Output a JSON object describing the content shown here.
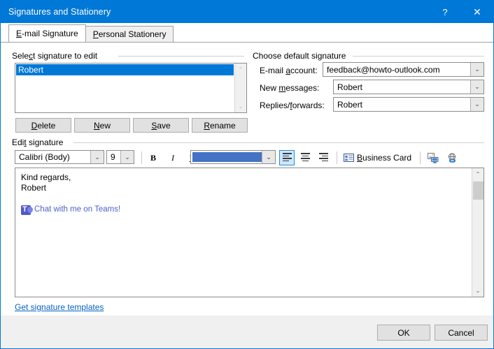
{
  "window": {
    "title": "Signatures and Stationery",
    "help_icon": "?",
    "close_icon": "✕",
    "accent_color": "#0078d7"
  },
  "tabs": [
    {
      "label_pre": "E",
      "label_key": "-",
      "label": "E-mail Signature",
      "accesskey": "E",
      "active": true
    },
    {
      "label": "Personal Stationery",
      "accesskey": "P",
      "active": false
    }
  ],
  "select_signature": {
    "group_label": "Select signature to edit",
    "group_accesskey": "c",
    "items": [
      {
        "name": "Robert",
        "selected": true
      }
    ],
    "scrollbar": {
      "up_icon": "⌃",
      "down_icon": "⌄",
      "disabled": true
    },
    "buttons": [
      {
        "label": "Delete",
        "accesskey": "D"
      },
      {
        "label": "New",
        "accesskey": "N"
      },
      {
        "label": "Save",
        "accesskey": "S"
      },
      {
        "label": "Rename",
        "accesskey": "R"
      }
    ]
  },
  "default_signature": {
    "group_label": "Choose default signature",
    "fields": [
      {
        "label": "E-mail account:",
        "accesskey": "a",
        "value": "feedback@howto-outlook.com"
      },
      {
        "label": "New messages:",
        "accesskey": "m",
        "value": "Robert"
      },
      {
        "label": "Replies/forwards:",
        "accesskey": "f",
        "value": "Robert"
      }
    ],
    "dropdown_icon": "⌄"
  },
  "edit_signature": {
    "group_label": "Edit signature",
    "group_accesskey": "t",
    "toolbar": {
      "font_name": "Calibri (Body)",
      "font_size": "9",
      "bold_label": "B",
      "italic_label": "I",
      "underline_label": "U",
      "font_color": "#4472c4",
      "dropdown_icon": "⌄",
      "align_left_label": "Align Left",
      "align_center_label": "Center",
      "align_right_label": "Align Right",
      "align_active": "left",
      "business_card_label": "Business Card",
      "business_card_accesskey": "B",
      "insert_picture_label": "Picture",
      "insert_hyperlink_label": "Hyperlink"
    },
    "content": {
      "lines": [
        "Kind regards,",
        "Robert"
      ],
      "teams_link": "Chat with me on Teams!",
      "teams_icon_color": "#5059c9"
    },
    "scrollbar": {
      "up_icon": "⌃",
      "down_icon": "⌄"
    }
  },
  "templates_link": {
    "label": "Get signature templates",
    "color": "#0563c1"
  },
  "footer": {
    "ok_label": "OK",
    "cancel_label": "Cancel"
  }
}
